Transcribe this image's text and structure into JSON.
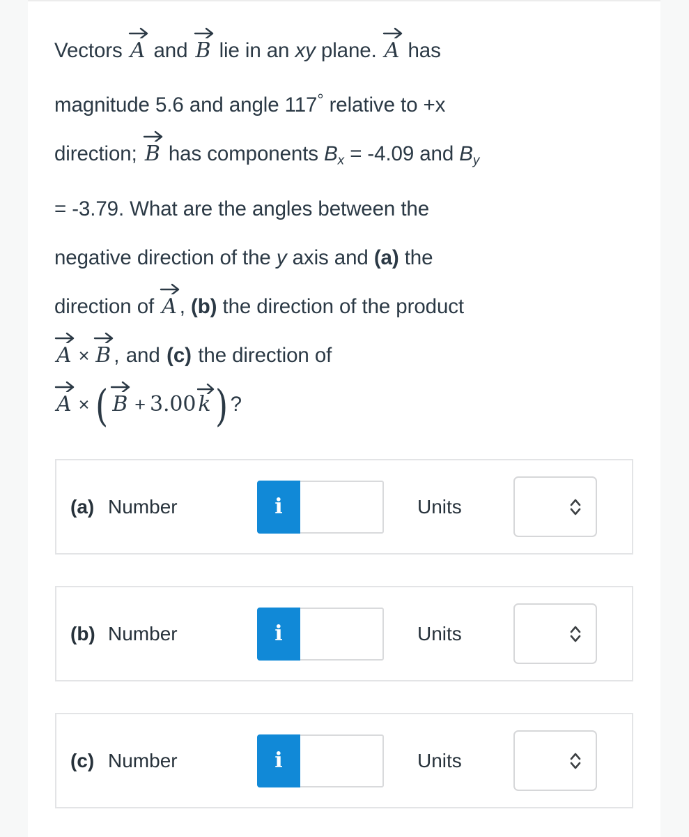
{
  "question": {
    "lines": [
      {
        "id": "l1",
        "text": "Vectors A and B lie in an xy plane. A has"
      },
      {
        "id": "l2",
        "text": "magnitude 5.6 and angle 117° relative to +x"
      },
      {
        "id": "l3",
        "text": "direction; B has components Bx = -4.09 and By"
      },
      {
        "id": "l4",
        "text": "= -3.79. What are the angles between the"
      },
      {
        "id": "l5",
        "text": "negative direction of the y axis and (a) the"
      },
      {
        "id": "l6",
        "text": "direction of A, (b) the direction of the product"
      },
      {
        "id": "l7",
        "text": "A × B, and (c) the direction of"
      },
      {
        "id": "l8",
        "text": "A × (B + 3.00 k)?"
      }
    ],
    "tokens": {
      "vectors_word": "Vectors",
      "and_word": "and",
      "lie_in_an": "lie in an",
      "xy": "xy",
      "plane_has": "plane.",
      "has": "has",
      "magnitude_word": "magnitude",
      "magnitude_value": "5.6",
      "and_angle": "and angle",
      "angle_value": "117",
      "degree_symbol": "°",
      "relative_to": "relative to +x",
      "direction_semicolon": "direction;",
      "has_components": "has components",
      "B_letter": "B",
      "sub_x": "x",
      "eq_bx": "= -4.09 and",
      "sub_y": "y",
      "eq_by": "= -3.79.",
      "what_are_angles": "What are the angles between the",
      "negative_direction": "negative direction of the",
      "y_axis": "y",
      "axis_and": "axis and",
      "part_a_bold": "(a)",
      "the_word": "the",
      "direction_of": "direction of",
      "comma": ",",
      "part_b_bold": "(b)",
      "the_direction_of_the_product": "the direction of the product",
      "and_word2": "and",
      "part_c_bold": "(c)",
      "the_direction_of": "the direction of",
      "cross": "×",
      "plus": "+",
      "coeff": "3.00",
      "k_hat": "k",
      "question_mark": "?",
      "vec_A": "A",
      "vec_B": "B",
      "paren_open": "(",
      "paren_close": ")"
    }
  },
  "answers": {
    "rows": [
      {
        "part": "(a)",
        "number_label": "Number",
        "info_glyph": "i",
        "number_value": "",
        "number_placeholder": "",
        "units_label": "Units",
        "units_value": "",
        "units_options": [
          ""
        ]
      },
      {
        "part": "(b)",
        "number_label": "Number",
        "info_glyph": "i",
        "number_value": "",
        "number_placeholder": "",
        "units_label": "Units",
        "units_value": "",
        "units_options": [
          ""
        ]
      },
      {
        "part": "(c)",
        "number_label": "Number",
        "info_glyph": "i",
        "number_value": "",
        "number_placeholder": "",
        "units_label": "Units",
        "units_value": "",
        "units_options": [
          ""
        ]
      }
    ]
  },
  "colors": {
    "accent_blue": "#1189d7",
    "text": "#2b3945",
    "panel_border": "#e3e4e6",
    "input_border": "#d9dadc",
    "page_background": "#f7f8f8",
    "card_background": "#ffffff"
  }
}
